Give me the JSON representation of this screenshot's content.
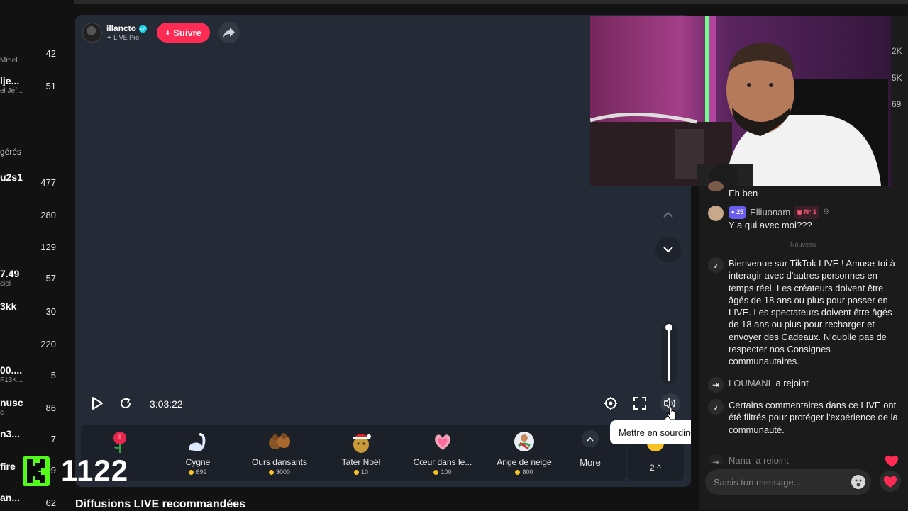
{
  "sidebar": {
    "rows": [
      {
        "name": "",
        "sub": "MmeL",
        "count": "42"
      },
      {
        "name": "lje...",
        "sub": "el Jéf...",
        "count": "51"
      },
      {
        "name": "u2s1",
        "sub": "",
        "count": "477"
      },
      {
        "name": "",
        "sub": "",
        "count": "280"
      },
      {
        "name": "",
        "sub": "",
        "count": "129"
      },
      {
        "name": "7.49",
        "sub": "ciel",
        "count": "57"
      },
      {
        "name": "3kk",
        "sub": "",
        "count": "30"
      },
      {
        "name": "",
        "sub": "",
        "count": "220"
      },
      {
        "name": "00....",
        "sub": "F13K...",
        "count": "5"
      },
      {
        "name": "nusc",
        "sub": "c",
        "count": "86"
      },
      {
        "name": "n3...",
        "sub": "",
        "count": "7"
      },
      {
        "name": "fire",
        "sub": "",
        "count": "09"
      },
      {
        "name": "an...",
        "sub": "",
        "count": "62"
      }
    ],
    "section_label": "gérés"
  },
  "streamer": {
    "name": "illancto",
    "subtitle": "LIVE Pro",
    "follow_label": "+ Suivre"
  },
  "player": {
    "elapsed": "3:03:22",
    "volume_level": 1.0,
    "tooltip": "Mettre en sourdine (M)"
  },
  "gifts": [
    {
      "name": "",
      "price": "",
      "icon": "rose-icon"
    },
    {
      "name": "Cygne",
      "price": "699",
      "icon": "swan-icon"
    },
    {
      "name": "Ours dansants",
      "price": "3000",
      "icon": "dancing-bears-icon"
    },
    {
      "name": "Tater Noël",
      "price": "10",
      "icon": "tater-icon"
    },
    {
      "name": "Cœur dans le...",
      "price": "100",
      "icon": "heart-hands-icon"
    },
    {
      "name": "Ange de neige",
      "price": "800",
      "icon": "snow-angel-icon"
    }
  ],
  "more_label": "More",
  "rank_label": "2",
  "recommended_title": "Diffusions LIVE recommandées",
  "right_strip": [
    "2K",
    "5K",
    "69"
  ],
  "chat": {
    "messages": [
      {
        "user": "",
        "text": "Eh ben"
      },
      {
        "user": "Elliuonam",
        "level": "25",
        "rank": "N° 1",
        "text": "Y a qui avec moi???"
      }
    ],
    "new_divider": "Nouveau",
    "system": [
      {
        "text": "Bienvenue sur TikTok LIVE ! Amuse-toi à interagir avec d'autres personnes en temps réel. Les créateurs doivent être âgés de 18 ans ou plus pour passer en LIVE. Les spectateurs doivent être âgés de 18 ans ou plus pour recharger et envoyer des Cadeaux. N'oublie pas de respecter nos Consignes communautaires."
      },
      {
        "user": "LOUMANI",
        "text": "a rejoint"
      },
      {
        "text": "Certains commentaires dans ce LIVE ont été filtrés pour protéger l'expérience de la communauté."
      },
      {
        "user": "Nana",
        "text": "a rejoint"
      }
    ],
    "input_placeholder": "Saisis ton message..."
  },
  "overlay": {
    "viewer_count": "1122"
  },
  "colors": {
    "accent": "#fe2c55",
    "player_bg": "#252b36",
    "kick_green": "#53fc18"
  }
}
